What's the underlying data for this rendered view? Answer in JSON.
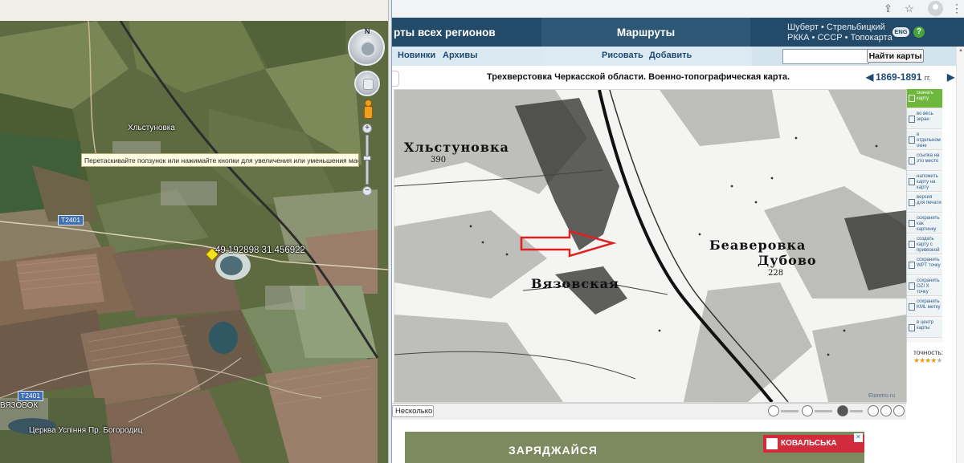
{
  "left_map": {
    "tooltip": "Перетаскивайте ползунок или нажимайте кнопки для увеличения или уменьшения масштаба",
    "compass_n": "N",
    "coordinates": "49.192898 31.456922",
    "places": {
      "khlystunovka": "Хльстуновка",
      "vyazovok": "ВЯЗОВОК",
      "church": "Церква Успіння Пр. Богородиц"
    },
    "road_labels": {
      "r1": "T2401",
      "r2": "T2401"
    },
    "zoom_plus": "+",
    "zoom_minus": "−",
    "colors": {
      "pin": "#f7e21c",
      "label_shadow": "#000000"
    }
  },
  "browser": {
    "header": {
      "all_regions": "рты всех регионов",
      "routes": "Маршруты",
      "line1": "Шуберт • Стрельбицкий",
      "line2": "РККА • СССР • Топокарта",
      "lang": "ENG",
      "help": "?"
    },
    "subnav": {
      "news": "Новинки",
      "archives": "Архивы",
      "draw": "Рисовать",
      "add": "Добавить",
      "search_button": "Найти карты",
      "search_value": ""
    },
    "map_title": "Трехверстовка Черкасской области. Военно-топографическая карта.",
    "years": {
      "range": "1869-1891",
      "suffix": "гг."
    },
    "map_labels": {
      "t1": "Хльстуновка",
      "t2": "390",
      "t3": "Вязовская",
      "t4": "Беаверовка",
      "t5": "Дубово",
      "t6": "228",
      "watermark": "Etoretro.ru"
    },
    "bottom": {
      "several": "Несколько"
    },
    "sidebar": [
      {
        "label": "скачать карту",
        "icon": "download-icon"
      },
      {
        "label": "во весь экран",
        "icon": "fullscreen-icon"
      },
      {
        "label": "в отдельном окне",
        "icon": "new-window-icon"
      },
      {
        "label": "ссылка на это место",
        "icon": "link-icon"
      },
      {
        "label": "наложить карту на карту",
        "icon": "overlay-icon"
      },
      {
        "label": "версия для печати",
        "icon": "print-icon"
      },
      {
        "label": "сохранить как картинку",
        "icon": "save-image-icon"
      },
      {
        "label": "создать карту с привязкой",
        "icon": "georef-icon"
      },
      {
        "label": "сохранить WPT точку",
        "icon": "wpt-icon"
      },
      {
        "label": "сохранить OZI X точку",
        "icon": "ozi-icon"
      },
      {
        "label": "сохранить KML метку",
        "icon": "kml-icon"
      },
      {
        "label": "в центр карты",
        "icon": "center-icon"
      }
    ],
    "precision": {
      "label": "точность:",
      "stars": 4,
      "max": 5
    },
    "ad": {
      "text": "ЗАРЯДЖАЙСЯ",
      "brand": "КОВАЛЬСЬКА"
    },
    "colors": {
      "header": "#234a68",
      "subnav": "#d9e9f3",
      "link": "#1f4a72",
      "active": "#6db83a",
      "arrow": "#e02020"
    }
  }
}
